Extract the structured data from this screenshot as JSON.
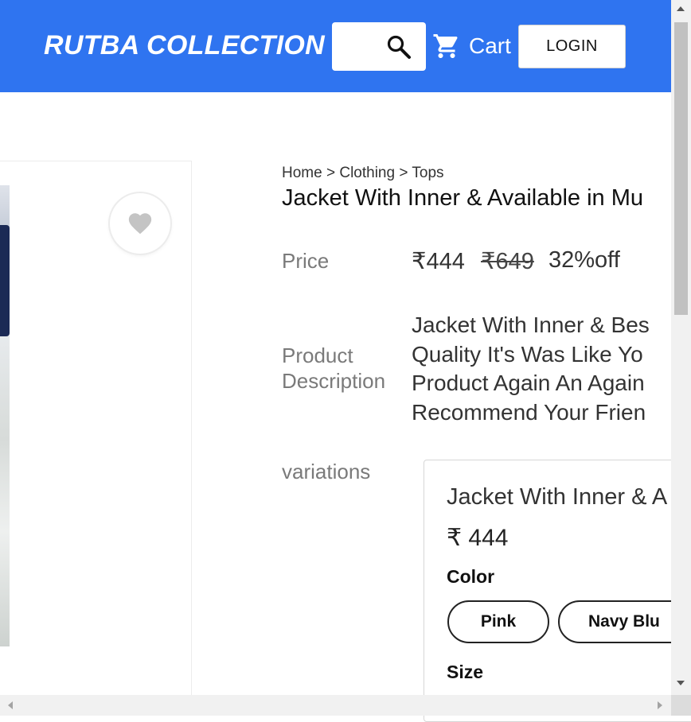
{
  "header": {
    "brand": "RUTBA COLLECTION",
    "cart_label": "Cart",
    "login_label": "LOGIN",
    "accent_color": "#2f74f0"
  },
  "icons": {
    "search": "search-icon",
    "cart": "cart-icon",
    "wishlist": "heart-icon"
  },
  "breadcrumb": {
    "home": "Home",
    "separator": ">",
    "category": "Clothing",
    "subcategory": "Tops"
  },
  "product": {
    "title": "Jacket With Inner & Available in Mu",
    "price_label": "Price",
    "price_current": "₹444",
    "price_original": "₹649",
    "discount": "32%off",
    "description_label": "Product Description",
    "description_lines": [
      "Jacket With Inner & Bes",
      "Quality It's Was Like Yo",
      "Product Again An Again",
      "Recommend Your Frien"
    ]
  },
  "variations": {
    "label": "variations",
    "card": {
      "title": "Jacket With Inner & A",
      "price": "₹ 444",
      "color_label": "Color",
      "colors": [
        "Pink",
        "Navy Blu"
      ],
      "size_label": "Size"
    }
  }
}
